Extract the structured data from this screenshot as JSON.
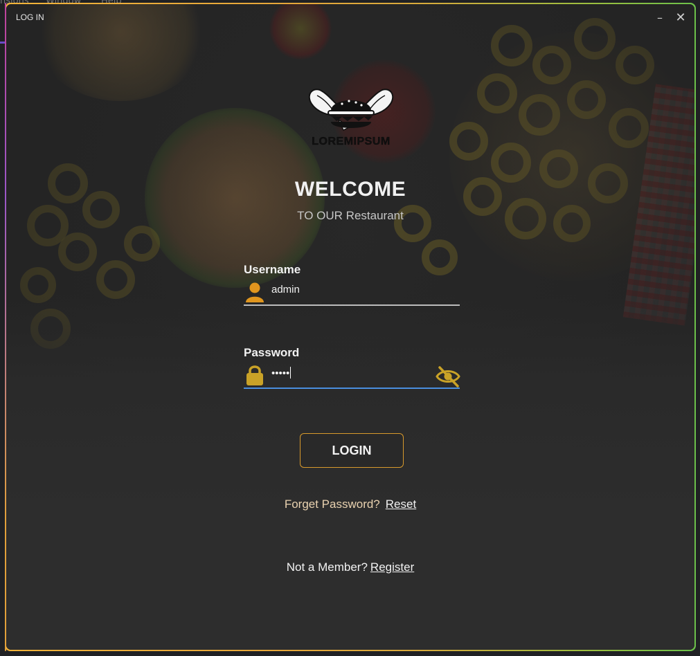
{
  "background_app": {
    "menu_items": [
      "nsions",
      "Window",
      "Help"
    ]
  },
  "window": {
    "title": "LOG IN",
    "minimize_glyph": "–",
    "close_glyph": "✕"
  },
  "logo": {
    "text": "LOREMIPSUM",
    "icon": "burger-logo-icon"
  },
  "heading": {
    "title": "WELCOME",
    "subtitle": "TO OUR Restaurant"
  },
  "username": {
    "label": "Username",
    "value": "admin",
    "icon": "user-icon"
  },
  "password": {
    "label": "Password",
    "masked_value": "•••••",
    "icon": "lock-icon",
    "toggle_icon": "eye-hidden-icon"
  },
  "login_button": {
    "label": "LOGIN"
  },
  "forgot": {
    "question": "Forget Password?",
    "link": "Reset"
  },
  "register": {
    "question": "Not a Member?",
    "link": "Register"
  },
  "colors": {
    "accent_gold": "#d89a2c",
    "icon_gold": "#c9a227",
    "focus_blue": "#4a8fe0"
  }
}
